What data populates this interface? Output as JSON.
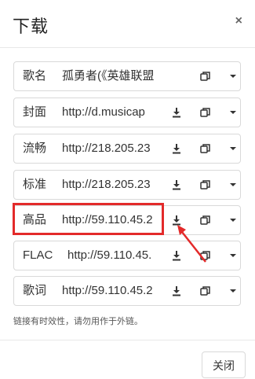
{
  "dialog": {
    "title": "下载",
    "close_glyph": "×",
    "note": "链接有时效性，请勿用作于外链。",
    "close_button": "关闭"
  },
  "rows": [
    {
      "label": "歌名",
      "value": "孤勇者(《英雄联盟：双"
    },
    {
      "label": "封面",
      "value": "http://d.musicap"
    },
    {
      "label": "流畅",
      "value": "http://218.205.23"
    },
    {
      "label": "标准",
      "value": "http://218.205.23"
    },
    {
      "label": "高品",
      "value": "http://59.110.45.2"
    },
    {
      "label": "FLAC",
      "value": "http://59.110.45."
    },
    {
      "label": "歌词",
      "value": "http://59.110.45.2"
    }
  ],
  "icons": {
    "download": "download-icon",
    "copy": "copy-icon",
    "dropdown": "caret-down-icon"
  },
  "colors": {
    "annotation": "#e32a2a",
    "border": "#d9d9d9"
  }
}
